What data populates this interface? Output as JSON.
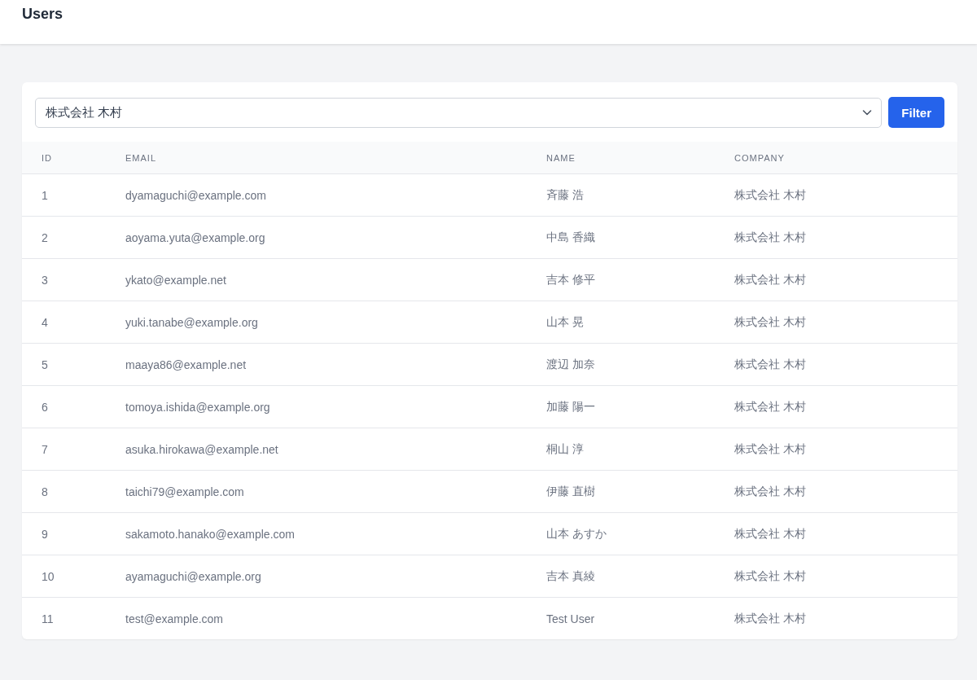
{
  "page": {
    "title": "Users"
  },
  "filter": {
    "value": "株式会社 木村",
    "button": "Filter"
  },
  "table": {
    "columns": [
      "ID",
      "EMAIL",
      "NAME",
      "COMPANY"
    ],
    "rows": [
      [
        "1",
        "dyamaguchi@example.com",
        "斉藤 浩",
        "株式会社 木村"
      ],
      [
        "2",
        "aoyama.yuta@example.org",
        "中島 香織",
        "株式会社 木村"
      ],
      [
        "3",
        "ykato@example.net",
        "吉本 修平",
        "株式会社 木村"
      ],
      [
        "4",
        "yuki.tanabe@example.org",
        "山本 晃",
        "株式会社 木村"
      ],
      [
        "5",
        "maaya86@example.net",
        "渡辺 加奈",
        "株式会社 木村"
      ],
      [
        "6",
        "tomoya.ishida@example.org",
        "加藤 陽一",
        "株式会社 木村"
      ],
      [
        "7",
        "asuka.hirokawa@example.net",
        "桐山 淳",
        "株式会社 木村"
      ],
      [
        "8",
        "taichi79@example.com",
        "伊藤 直樹",
        "株式会社 木村"
      ],
      [
        "9",
        "sakamoto.hanako@example.com",
        "山本 あすか",
        "株式会社 木村"
      ],
      [
        "10",
        "ayamaguchi@example.org",
        "吉本 真綾",
        "株式会社 木村"
      ],
      [
        "11",
        "test@example.com",
        "Test User",
        "株式会社 木村"
      ]
    ]
  }
}
